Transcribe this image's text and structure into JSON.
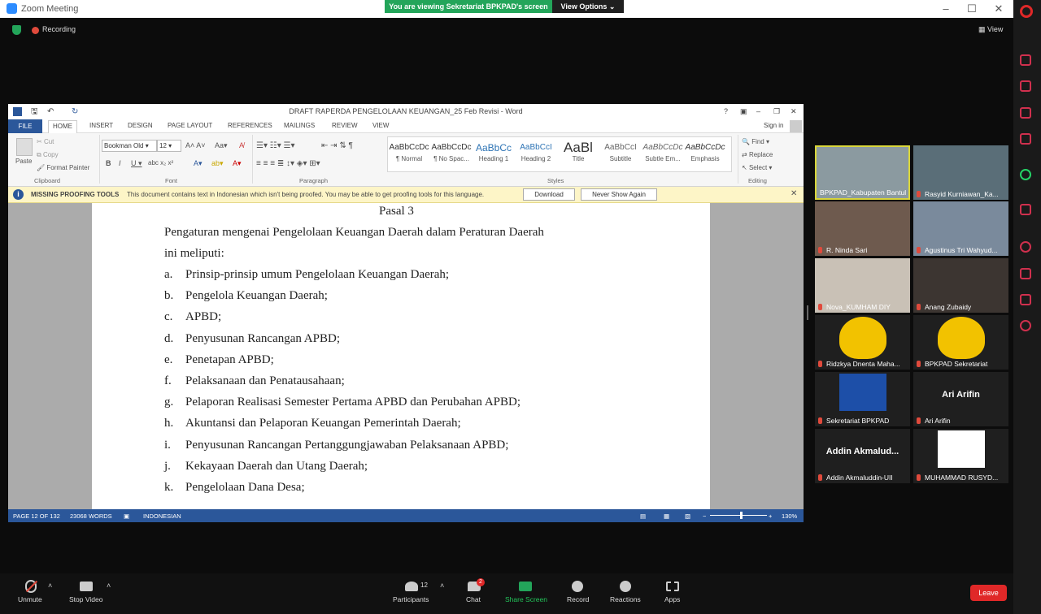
{
  "zoom": {
    "title": "Zoom Meeting",
    "share_banner": "You are viewing Sekretariat BPKPAD's screen",
    "view_options": "View Options",
    "recording": "Recording",
    "view": "View"
  },
  "word": {
    "title": "DRAFT RAPERDA PENGELOLAAN KEUANGAN_25 Feb Revisi - Word",
    "help": "?",
    "sign_in": "Sign in",
    "tabs": [
      "FILE",
      "HOME",
      "INSERT",
      "DESIGN",
      "PAGE LAYOUT",
      "REFERENCES",
      "MAILINGS",
      "REVIEW",
      "VIEW"
    ],
    "clipboard": {
      "paste": "Paste",
      "cut": "Cut",
      "copy": "Copy",
      "format_painter": "Format Painter",
      "group": "Clipboard"
    },
    "font": {
      "name": "Bookman Old",
      "size": "12",
      "group": "Font"
    },
    "paragraph_group": "Paragraph",
    "styles": [
      {
        "preview": "AaBbCcDc",
        "name": "¶ Normal"
      },
      {
        "preview": "AaBbCcDc",
        "name": "¶ No Spac..."
      },
      {
        "preview": "AaBbCc",
        "name": "Heading 1"
      },
      {
        "preview": "AaBbCcI",
        "name": "Heading 2"
      },
      {
        "preview": "AaBl",
        "name": "Title"
      },
      {
        "preview": "AaBbCcI",
        "name": "Subtitle"
      },
      {
        "preview": "AaBbCcDc",
        "name": "Subtle Em..."
      },
      {
        "preview": "AaBbCcDc",
        "name": "Emphasis"
      }
    ],
    "styles_group": "Styles",
    "editing": {
      "find": "Find",
      "replace": "Replace",
      "select": "Select",
      "group": "Editing"
    },
    "message": {
      "title": "MISSING PROOFING TOOLS",
      "text": "This document contains text in Indonesian which isn't being proofed. You may be able to get proofing tools for this language.",
      "download": "Download",
      "never": "Never Show Again"
    },
    "document": {
      "heading": "Pasal 3",
      "intro1": "Pengaturan mengenai Pengelolaan Keuangan Daerah dalam Peraturan Daerah",
      "intro2": "ini meliputi:",
      "items": [
        {
          "letter": "a.",
          "text": "Prinsip-prinsip umum Pengelolaan Keuangan Daerah;"
        },
        {
          "letter": "b.",
          "text": "Pengelola Keuangan Daerah;"
        },
        {
          "letter": "c.",
          "text": "APBD;"
        },
        {
          "letter": "d.",
          "text": "Penyusunan Rancangan APBD;"
        },
        {
          "letter": "e.",
          "text": "Penetapan APBD;"
        },
        {
          "letter": "f.",
          "text": "Pelaksanaan dan Penatausahaan;"
        },
        {
          "letter": "g.",
          "text": "Pelaporan Realisasi Semester Pertama APBD dan Perubahan APBD;"
        },
        {
          "letter": "h.",
          "text": "Akuntansi dan Pelaporan Keuangan Pemerintah Daerah;"
        },
        {
          "letter": "i.",
          "text": "Penyusunan Rancangan Pertanggungjawaban Pelaksanaan APBD;"
        },
        {
          "letter": "j.",
          "text": "Kekayaan Daerah dan Utang Daerah;"
        },
        {
          "letter": "k.",
          "text": "Pengelolaan Dana Desa;"
        }
      ]
    },
    "status": {
      "page": "PAGE 12 OF 132",
      "words": "23068 WORDS",
      "language": "INDONESIAN",
      "zoom": "130%",
      "zoom_level_percent": 130
    }
  },
  "participants_tiles": [
    {
      "name": "BPKPAD_Kabupaten Bantul",
      "muted": false,
      "text": ""
    },
    {
      "name": "Rasyid Kurniawan_Ka...",
      "muted": true,
      "text": ""
    },
    {
      "name": "R. Ninda Sari",
      "muted": true,
      "text": ""
    },
    {
      "name": "Agustinus Tri Wahyud...",
      "muted": true,
      "text": ""
    },
    {
      "name": "Nova_KUMHAM DIY",
      "muted": true,
      "text": ""
    },
    {
      "name": "Anang Zubaidy",
      "muted": true,
      "text": ""
    },
    {
      "name": "Ridzkya Dnenta Maha...",
      "muted": true,
      "text": ""
    },
    {
      "name": "BPKPAD Sekretariat",
      "muted": true,
      "text": ""
    },
    {
      "name": "Sekretariat BPKPAD",
      "muted": true,
      "text": ""
    },
    {
      "name": "Ari Arifin",
      "muted": true,
      "text": "Ari Arifin"
    },
    {
      "name": "Addin Akmaluddin-UII",
      "muted": true,
      "text": "Addin Akmalud..."
    },
    {
      "name": "MUHAMMAD RUSYD...",
      "muted": true,
      "text": ""
    }
  ],
  "toolbar": {
    "unmute": "Unmute",
    "stop_video": "Stop Video",
    "participants": "Participants",
    "participants_count": "12",
    "chat": "Chat",
    "chat_badge": "2",
    "share_screen": "Share Screen",
    "record": "Record",
    "reactions": "Reactions",
    "apps": "Apps",
    "leave": "Leave"
  }
}
